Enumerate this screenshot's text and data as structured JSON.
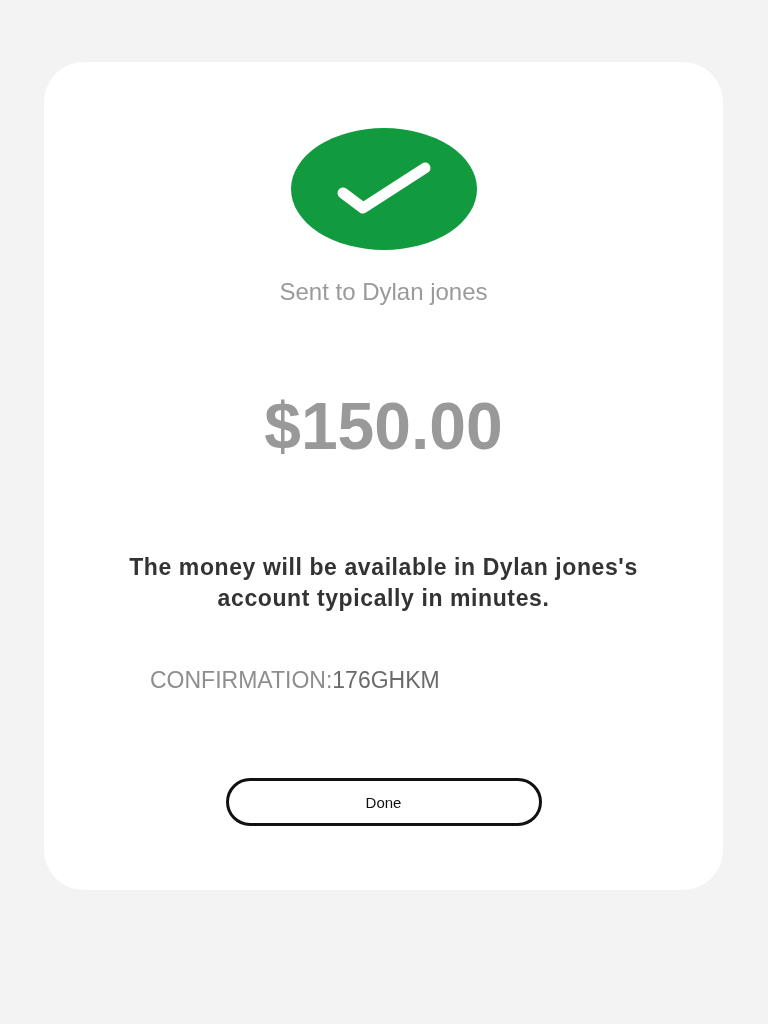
{
  "recipient_line": "Sent to Dylan jones",
  "amount": "$150.00",
  "message": "The money will be available in Dylan jones's account typically in minutes.",
  "confirmation": {
    "label": "CONFIRMATION:",
    "code": "176GHKM"
  },
  "button": "Done"
}
